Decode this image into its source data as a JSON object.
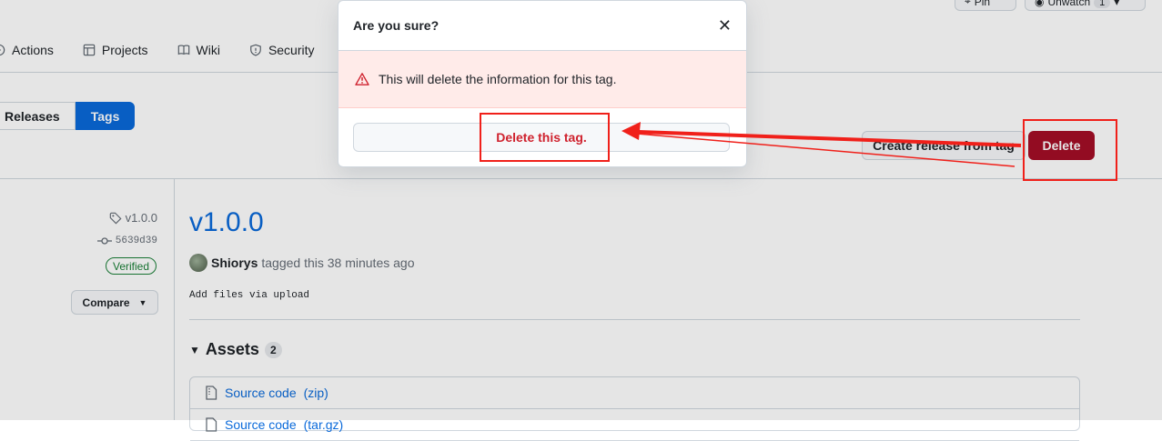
{
  "top_buttons": {
    "pin_label": "Pin",
    "unwatch_label": "Unwatch",
    "unwatch_count": "1"
  },
  "repo_nav": [
    {
      "label": "Actions",
      "icon": "play-icon"
    },
    {
      "label": "Projects",
      "icon": "table-icon"
    },
    {
      "label": "Wiki",
      "icon": "book-icon"
    },
    {
      "label": "Security",
      "icon": "shield-icon"
    }
  ],
  "subnav": {
    "releases_label": "Releases",
    "tags_label": "Tags"
  },
  "actions": {
    "create_release_label": "Create release from tag",
    "delete_label": "Delete"
  },
  "sidebar": {
    "tag_name": "v1.0.0",
    "commit_sha": "5639d39",
    "verified_label": "Verified",
    "compare_label": "Compare"
  },
  "release": {
    "title": "v1.0.0",
    "author": "Shiorys",
    "tagged_text": "tagged this 38 minutes ago",
    "commit_message": "Add files via upload"
  },
  "assets": {
    "heading": "Assets",
    "count": "2",
    "items": [
      {
        "name": "Source code",
        "ext": "(zip)"
      },
      {
        "name": "Source code",
        "ext": "(tar.gz)"
      }
    ]
  },
  "modal": {
    "title": "Are you sure?",
    "warning": "This will delete the information for this tag.",
    "confirm_label": "Delete this tag."
  },
  "colors": {
    "accent": "#0969da",
    "danger": "#a40e26",
    "annotation": "#f0201a"
  }
}
